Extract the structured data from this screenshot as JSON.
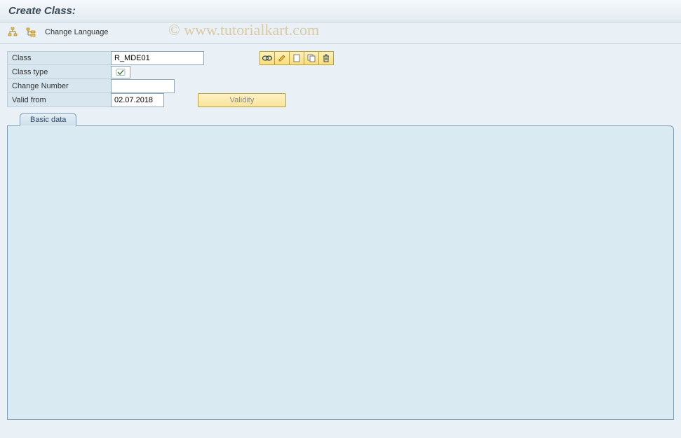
{
  "header": {
    "title": "Create Class:"
  },
  "toolbar": {
    "change_language": "Change Language"
  },
  "icons": {
    "tree": "tree-icon",
    "structure": "structure-icon",
    "display": "display-icon",
    "edit": "edit-icon",
    "create": "create-icon",
    "copy": "copy-icon",
    "delete": "delete-icon"
  },
  "form": {
    "class_label": "Class",
    "class_value": "R_MDE01",
    "class_type_label": "Class type",
    "class_type_check": "✓",
    "change_number_label": "Change Number",
    "change_number_value": "",
    "valid_from_label": "Valid from",
    "valid_from_value": "02.07.2018",
    "validity_button": "Validity"
  },
  "tabs": {
    "basic_data": "Basic data"
  },
  "watermark": "© www.tutorialkart.com"
}
